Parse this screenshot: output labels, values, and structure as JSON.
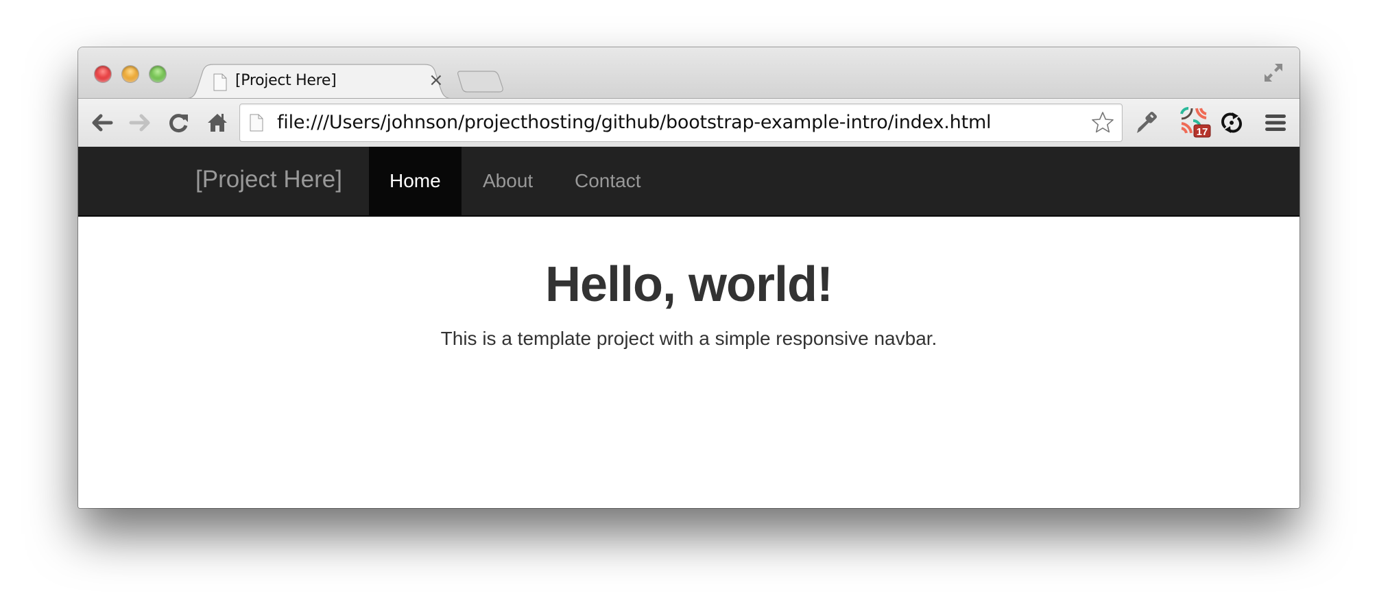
{
  "window": {
    "traffic_lights": [
      "close",
      "minimize",
      "zoom"
    ]
  },
  "tabs": [
    {
      "title": "[Project Here]",
      "icon": "page-icon",
      "close_label": "×",
      "active": true
    }
  ],
  "toolbar": {
    "back_icon": "arrow-left-icon",
    "forward_icon": "arrow-right-icon",
    "reload_icon": "reload-icon",
    "home_icon": "home-icon",
    "url": "file:///Users/johnson/projecthosting/github/bootstrap-example-intro/index.html",
    "bookmark_icon": "star-icon",
    "extensions": [
      {
        "name": "key-icon"
      },
      {
        "name": "extension-icon",
        "badge": "17"
      },
      {
        "name": "sync-icon"
      }
    ],
    "menu_icon": "hamburger-icon"
  },
  "navbar": {
    "brand": "[Project Here]",
    "items": [
      {
        "label": "Home",
        "active": true
      },
      {
        "label": "About",
        "active": false
      },
      {
        "label": "Contact",
        "active": false
      }
    ]
  },
  "hero": {
    "title": "Hello, world!",
    "subtitle": "This is a template project with a simple responsive navbar."
  },
  "colors": {
    "navbar_bg": "#222222",
    "navbar_active_bg": "#080808",
    "navbar_text": "#999999",
    "navbar_active_text": "#ffffff",
    "body_text": "#333333",
    "badge": "#b5332b"
  }
}
